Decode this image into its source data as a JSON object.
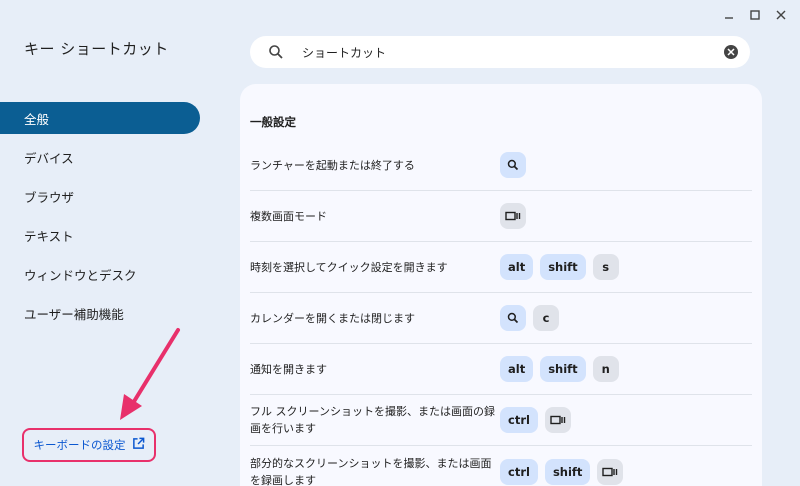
{
  "app": {
    "title": "キー ショートカット"
  },
  "window_controls": [
    "minimize-icon",
    "maximize-icon",
    "close-icon"
  ],
  "sidebar": {
    "items": [
      {
        "label": "全般",
        "active": true
      },
      {
        "label": "デバイス",
        "active": false
      },
      {
        "label": "ブラウザ",
        "active": false
      },
      {
        "label": "テキスト",
        "active": false
      },
      {
        "label": "ウィンドウとデスク",
        "active": false
      },
      {
        "label": "ユーザー補助機能",
        "active": false
      }
    ],
    "keyboard_settings_label": "キーボードの設定"
  },
  "search": {
    "value": "ショートカット"
  },
  "section": {
    "title": "一般設定",
    "rows": [
      {
        "label": "ランチャーを起動または終了する",
        "keys": [
          {
            "type": "icon",
            "icon": "search-icon"
          }
        ]
      },
      {
        "label": "複数画面モード",
        "keys": [
          {
            "type": "icon",
            "icon": "overview-icon",
            "gray": true
          }
        ]
      },
      {
        "label": "時刻を選択してクイック設定を開きます",
        "keys": [
          {
            "type": "text",
            "text": "alt"
          },
          {
            "type": "text",
            "text": "shift"
          },
          {
            "type": "text",
            "text": "s",
            "gray": true
          }
        ]
      },
      {
        "label": "カレンダーを開くまたは閉じます",
        "keys": [
          {
            "type": "icon",
            "icon": "search-icon"
          },
          {
            "type": "text",
            "text": "c",
            "gray": true
          }
        ]
      },
      {
        "label": "通知を開きます",
        "keys": [
          {
            "type": "text",
            "text": "alt"
          },
          {
            "type": "text",
            "text": "shift"
          },
          {
            "type": "text",
            "text": "n",
            "gray": true
          }
        ]
      },
      {
        "label": "フル スクリーンショットを撮影、または画面の録画を行います",
        "keys": [
          {
            "type": "text",
            "text": "ctrl"
          },
          {
            "type": "icon",
            "icon": "overview-icon",
            "gray": true
          }
        ]
      },
      {
        "label": "部分的なスクリーンショットを撮影、または画面を録画します",
        "keys": [
          {
            "type": "text",
            "text": "ctrl"
          },
          {
            "type": "text",
            "text": "shift"
          },
          {
            "type": "icon",
            "icon": "overview-icon",
            "gray": true
          }
        ]
      }
    ]
  },
  "colors": {
    "accent": "#0b5e93",
    "key_blue": "#d3e3fd",
    "key_gray": "#e0e3ea",
    "highlight": "#e8306b",
    "link": "#0b57d0"
  }
}
